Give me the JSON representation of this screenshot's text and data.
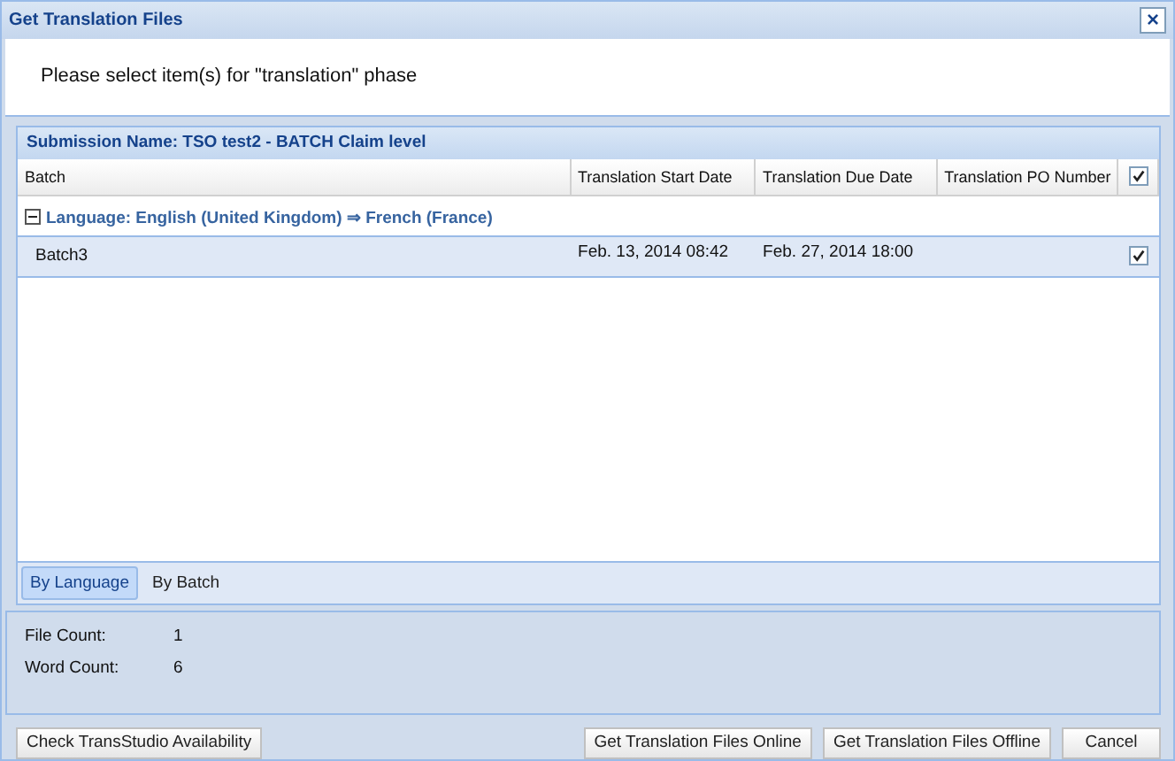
{
  "window": {
    "title": "Get Translation Files",
    "close": "×"
  },
  "instruction": "Please select item(s) for \"translation\" phase",
  "grid": {
    "title": "Submission Name: TSO test2 - BATCH Claim level",
    "columns": [
      "Batch",
      "Translation Start Date",
      "Translation Due Date",
      "Translation PO Number"
    ],
    "header_checked": true,
    "groups": [
      {
        "label": "Language: English (United Kingdom) ⇒ French (France)",
        "expanded": true,
        "rows": [
          {
            "cells": [
              "Batch3",
              "Feb. 13, 2014 08:42",
              "Feb. 27, 2014 18:00",
              ""
            ],
            "checked": true,
            "selected": true
          }
        ]
      }
    ]
  },
  "tabs": [
    {
      "label": "By Language",
      "selected": true
    },
    {
      "label": "By Batch",
      "selected": false
    }
  ],
  "counts": [
    {
      "label": "File Count:",
      "value": "1"
    },
    {
      "label": "Word Count:",
      "value": "6"
    }
  ],
  "left_button": "Check TransStudio Availability",
  "buttons": [
    "Get Translation Files Online",
    "Get Translation Files Offline",
    "Cancel"
  ]
}
